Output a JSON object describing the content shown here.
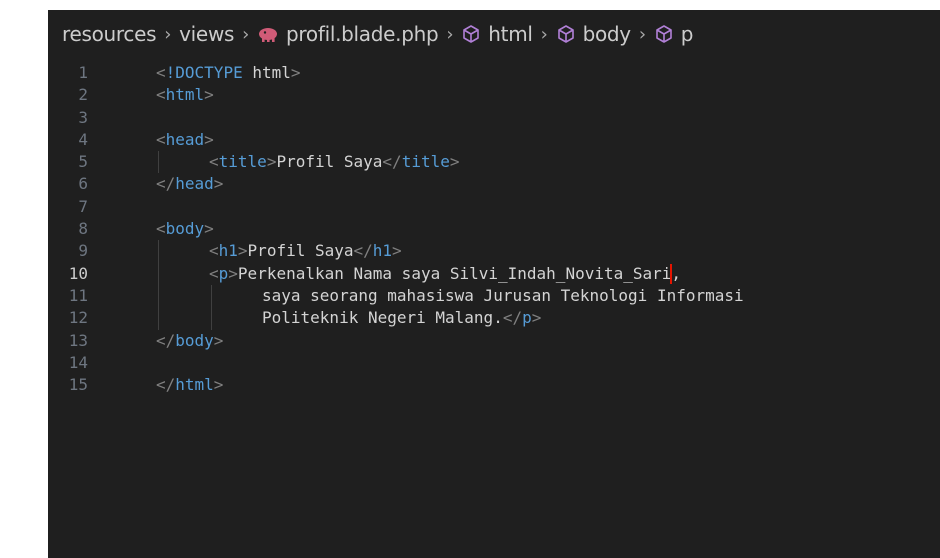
{
  "breadcrumb": {
    "items": [
      {
        "label": "resources",
        "icon": null
      },
      {
        "label": "views",
        "icon": null
      },
      {
        "label": "profil.blade.php",
        "icon": "php-elephant-icon"
      },
      {
        "label": "html",
        "icon": "cube-outline-icon"
      },
      {
        "label": "body",
        "icon": "cube-outline-icon"
      },
      {
        "label": "p",
        "icon": "cube-outline-icon"
      }
    ],
    "separator": "›"
  },
  "editor": {
    "active_line": 10,
    "colors": {
      "background": "#1f1f1f",
      "tag": "#569cd6",
      "bracket": "#808080",
      "text": "#d4d4d4",
      "line_number": "#6e7681",
      "cursor": "#e51400",
      "php_icon": "#d05b77"
    },
    "lines": [
      {
        "number": "1",
        "indent": 0,
        "tokens": [
          {
            "t": "punc",
            "v": "<"
          },
          {
            "t": "tag",
            "v": "!DOCTYPE"
          },
          {
            "t": "txt",
            "v": " html"
          },
          {
            "t": "punc",
            "v": ">"
          }
        ]
      },
      {
        "number": "2",
        "indent": 0,
        "tokens": [
          {
            "t": "punc",
            "v": "<"
          },
          {
            "t": "tag",
            "v": "html"
          },
          {
            "t": "punc",
            "v": ">"
          }
        ]
      },
      {
        "number": "3",
        "indent": 0,
        "tokens": []
      },
      {
        "number": "4",
        "indent": 0,
        "tokens": [
          {
            "t": "punc",
            "v": "<"
          },
          {
            "t": "tag",
            "v": "head"
          },
          {
            "t": "punc",
            "v": ">"
          }
        ]
      },
      {
        "number": "5",
        "indent": 1,
        "tokens": [
          {
            "t": "punc",
            "v": "<"
          },
          {
            "t": "tag",
            "v": "title"
          },
          {
            "t": "punc",
            "v": ">"
          },
          {
            "t": "txt",
            "v": "Profil Saya"
          },
          {
            "t": "punc",
            "v": "</"
          },
          {
            "t": "tag",
            "v": "title"
          },
          {
            "t": "punc",
            "v": ">"
          }
        ]
      },
      {
        "number": "6",
        "indent": 0,
        "tokens": [
          {
            "t": "punc",
            "v": "</"
          },
          {
            "t": "tag",
            "v": "head"
          },
          {
            "t": "punc",
            "v": ">"
          }
        ]
      },
      {
        "number": "7",
        "indent": 0,
        "tokens": []
      },
      {
        "number": "8",
        "indent": 0,
        "tokens": [
          {
            "t": "punc",
            "v": "<"
          },
          {
            "t": "tag",
            "v": "body"
          },
          {
            "t": "punc",
            "v": ">"
          }
        ]
      },
      {
        "number": "9",
        "indent": 1,
        "tokens": [
          {
            "t": "punc",
            "v": "<"
          },
          {
            "t": "tag",
            "v": "h1"
          },
          {
            "t": "punc",
            "v": ">"
          },
          {
            "t": "txt",
            "v": "Profil Saya"
          },
          {
            "t": "punc",
            "v": "</"
          },
          {
            "t": "tag",
            "v": "h1"
          },
          {
            "t": "punc",
            "v": ">"
          }
        ]
      },
      {
        "number": "10",
        "indent": 1,
        "tokens": [
          {
            "t": "punc",
            "v": "<"
          },
          {
            "t": "tag",
            "v": "p"
          },
          {
            "t": "punc",
            "v": ">"
          },
          {
            "t": "txt",
            "v": "Perkenalkan Nama saya Silvi_Indah_Novita_Sari"
          },
          {
            "t": "cursor",
            "v": ""
          },
          {
            "t": "txt",
            "v": ","
          }
        ]
      },
      {
        "number": "11",
        "indent": 2,
        "tokens": [
          {
            "t": "txt",
            "v": "saya seorang mahasiswa Jurusan Teknologi Informasi"
          }
        ]
      },
      {
        "number": "12",
        "indent": 2,
        "tokens": [
          {
            "t": "txt",
            "v": "Politeknik Negeri Malang."
          },
          {
            "t": "punc",
            "v": "</"
          },
          {
            "t": "tag",
            "v": "p"
          },
          {
            "t": "punc",
            "v": ">"
          }
        ]
      },
      {
        "number": "13",
        "indent": 0,
        "tokens": [
          {
            "t": "punc",
            "v": "</"
          },
          {
            "t": "tag",
            "v": "body"
          },
          {
            "t": "punc",
            "v": ">"
          }
        ]
      },
      {
        "number": "14",
        "indent": 0,
        "tokens": []
      },
      {
        "number": "15",
        "indent": 0,
        "tokens": [
          {
            "t": "punc",
            "v": "</"
          },
          {
            "t": "tag",
            "v": "html"
          },
          {
            "t": "punc",
            "v": ">"
          }
        ]
      }
    ]
  }
}
